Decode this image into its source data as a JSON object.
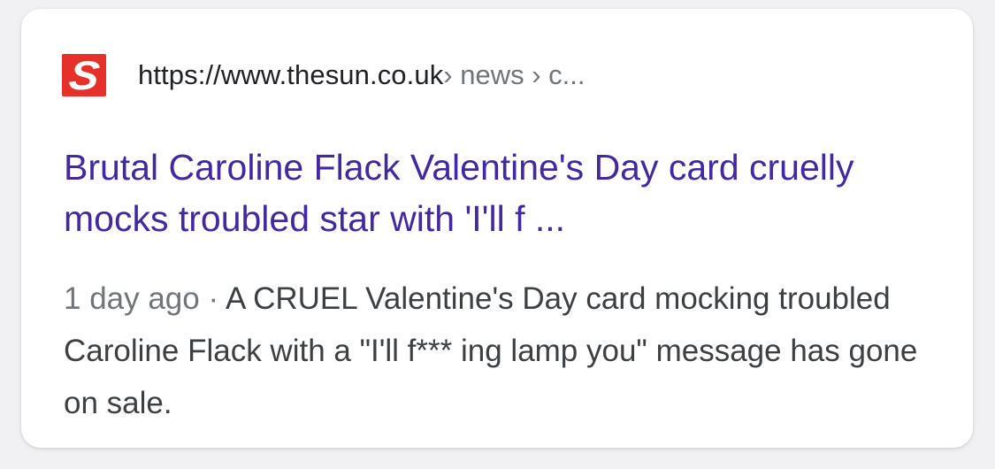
{
  "result": {
    "favicon_letter": "S",
    "favicon_color": "#e5312a",
    "url_domain": "https://www.thesun.co.uk",
    "url_path": " › news › c...",
    "title": "Brutal Caroline Flack Valentine's Day card cruelly mocks troubled star with 'I'll f ...",
    "title_color": "#4428a2",
    "date": "1 day ago",
    "separator": " · ",
    "snippet": "A CRUEL Valentine's Day card mocking troubled Caroline Flack with a \"I'll f*** ing lamp you\" message has gone on sale."
  }
}
